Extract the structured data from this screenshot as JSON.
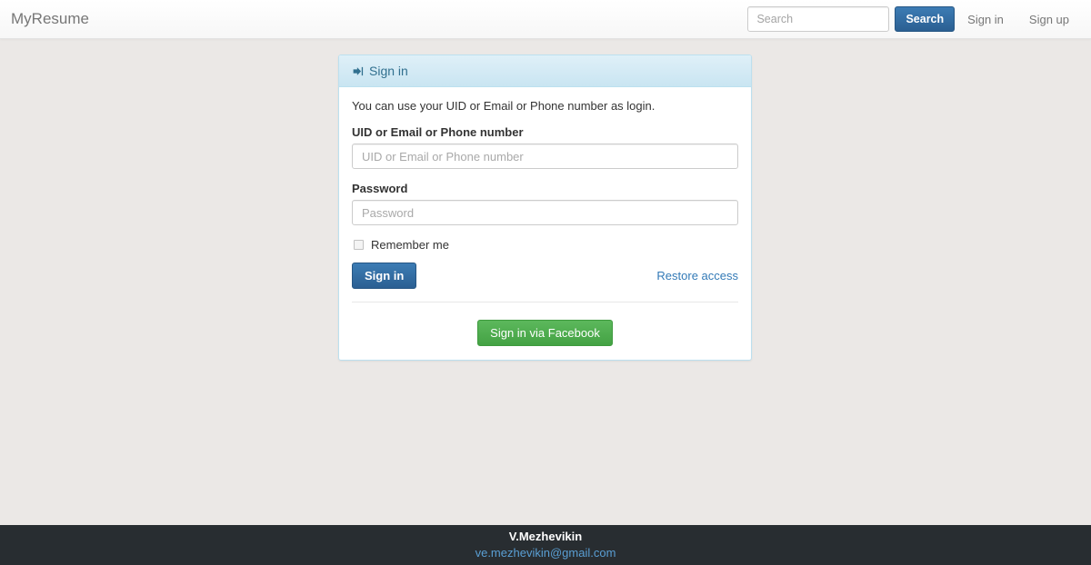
{
  "navbar": {
    "brand": "MyResume",
    "search": {
      "placeholder": "Search",
      "value": "",
      "button_label": "Search"
    },
    "links": [
      {
        "label": "Sign in"
      },
      {
        "label": "Sign up"
      }
    ]
  },
  "panel": {
    "heading": "Sign in",
    "heading_icon": "sign-in-arrow-icon",
    "help_text": "You can use your UID or Email or Phone number as login.",
    "login_field": {
      "label": "UID or Email or Phone number",
      "placeholder": "UID or Email or Phone number",
      "value": ""
    },
    "password_field": {
      "label": "Password",
      "placeholder": "Password",
      "value": ""
    },
    "remember": {
      "label": "Remember me",
      "checked": false
    },
    "submit_label": "Sign in",
    "restore_link": "Restore access",
    "facebook_label": "Sign in via Facebook"
  },
  "footer": {
    "name": "V.Mezhevikin",
    "email": "ve.mezhevikin@gmail.com"
  },
  "colors": {
    "page_background": "#ebe8e6",
    "navbar_background": "#f8f8f8",
    "panel_header": "#dff0f8",
    "panel_border": "#bce0ef",
    "heading_text": "#31708f",
    "primary_button": "#2b5f92",
    "facebook_button": "#5cb85c",
    "link": "#337ab7",
    "footer_background": "#282d31",
    "footer_link": "#5a9fd4"
  }
}
